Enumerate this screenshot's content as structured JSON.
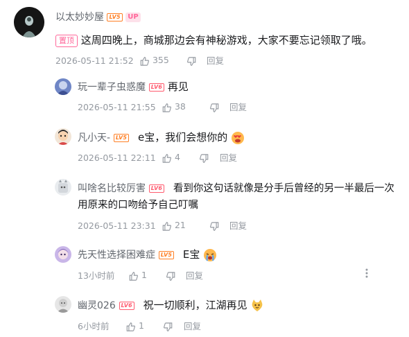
{
  "main_comment": {
    "username": "以太妙妙屋",
    "level": "LV5",
    "up_badge": "UP",
    "pin_label": "置顶",
    "text": "这周四晚上，商城那边会有神秘游戏，大家不要忘记领取了哦。",
    "time": "2026-05-11 21:52",
    "likes": "355",
    "reply_label": "回复"
  },
  "replies": [
    {
      "username": "玩一辈子虫惑魔",
      "level": "LV6",
      "text": "再见",
      "time": "2026-05-11 21:55",
      "likes": "38",
      "reply_label": "回复"
    },
    {
      "username": "凡小天-",
      "level": "LV5",
      "text": "e宝，我们会想你的",
      "time": "2026-05-11 22:11",
      "likes": "4",
      "reply_label": "回复"
    },
    {
      "username": "叫啥名比较厉害",
      "level": "LV6",
      "text_line1": "看到你这句话就像是分手后曾经的另一半最后一次",
      "text_line2": "用原来的口吻给予自己叮嘱",
      "time": "2026-05-11 23:31",
      "likes": "21",
      "reply_label": "回复"
    },
    {
      "username": "先天性选择困难症",
      "level": "LV5",
      "text": "E宝",
      "time": "13小时前",
      "likes": "1",
      "reply_label": "回复"
    },
    {
      "username": "幽灵026",
      "level": "LV6",
      "text": "祝一切顺利，江湖再见",
      "time": "6小时前",
      "likes": "1",
      "reply_label": "回复"
    }
  ],
  "icons": {
    "like": "thumbs-up-icon",
    "dislike": "thumbs-down-icon",
    "more": "more-dots-icon"
  },
  "colors": {
    "pink": "#ff6699",
    "level5": "#ff7f24",
    "level6": "#ff5a6e",
    "meta": "#9499a0"
  }
}
